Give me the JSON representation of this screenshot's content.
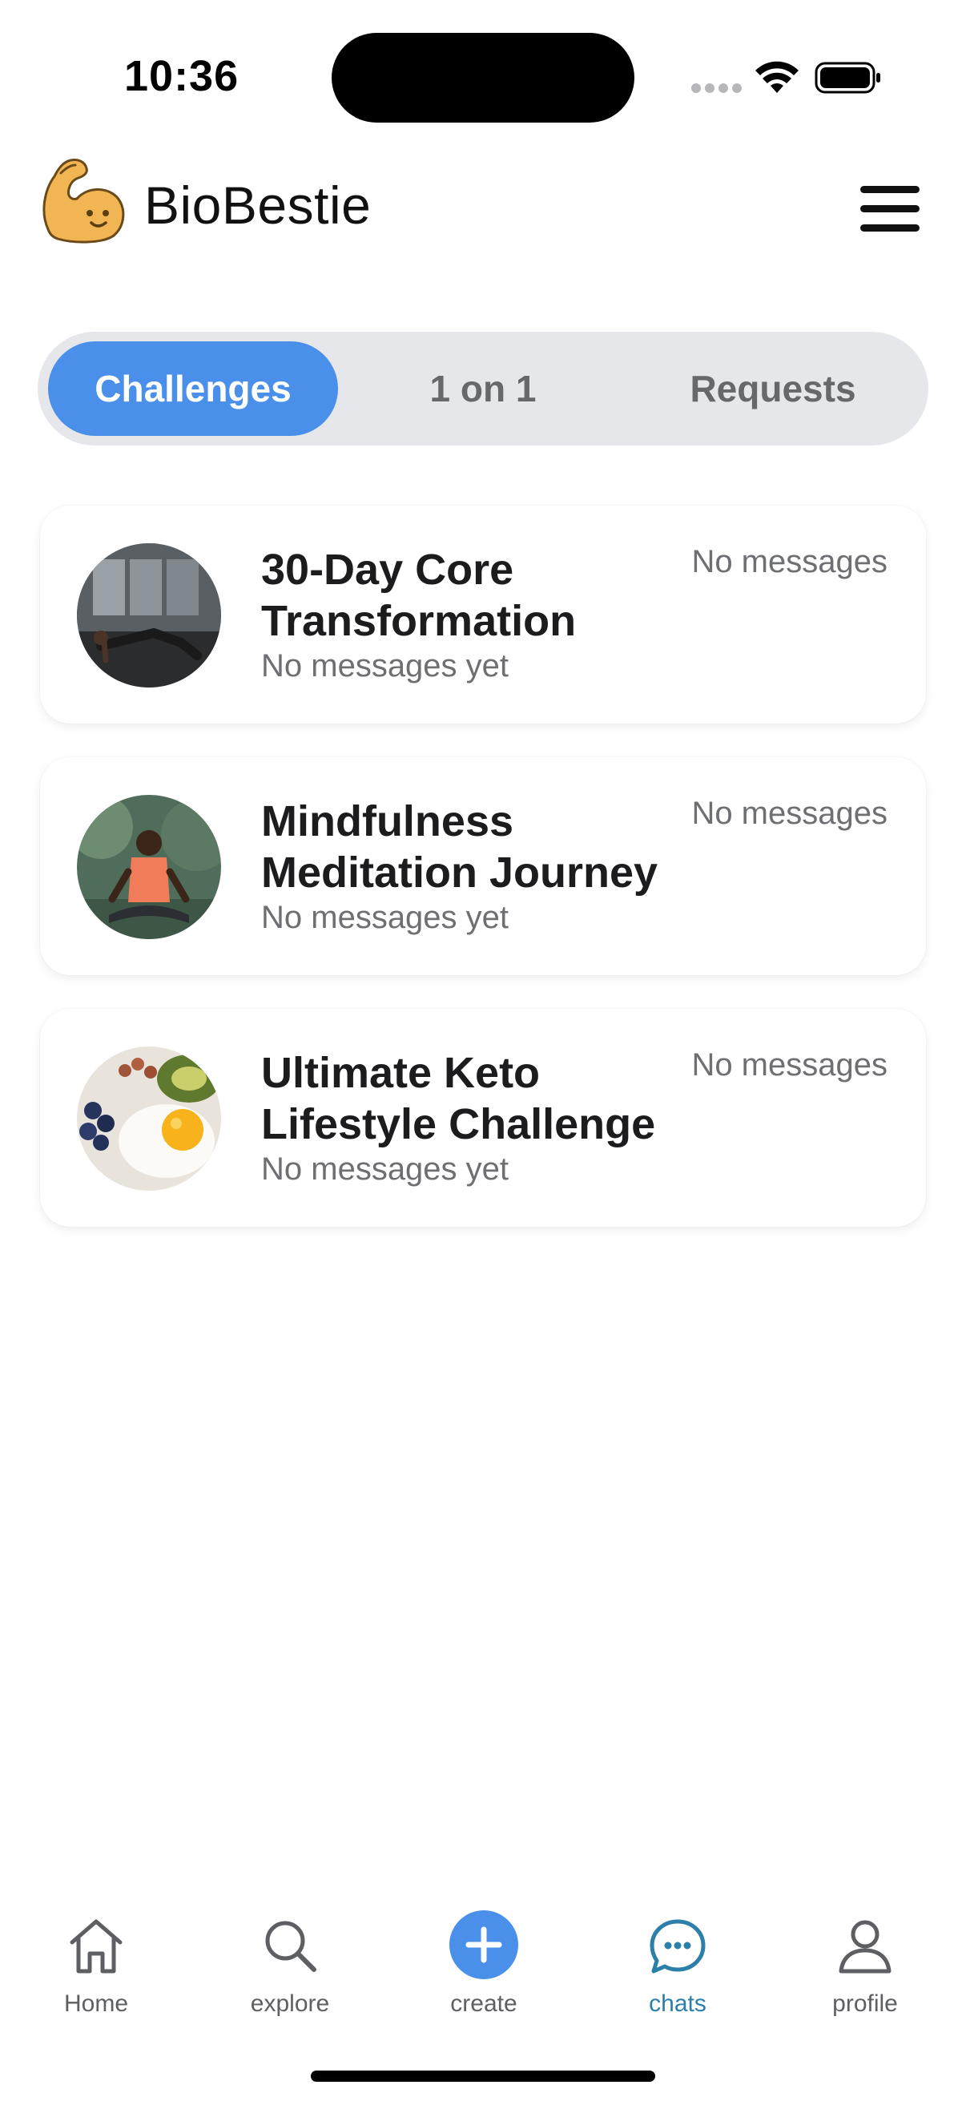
{
  "status_bar": {
    "time": "10:36"
  },
  "header": {
    "app_name": "BioBestie",
    "logo_icon": "flexed-biceps-icon",
    "menu_icon": "hamburger-menu-icon"
  },
  "tabs": [
    {
      "label": "Challenges",
      "active": true
    },
    {
      "label": "1 on 1",
      "active": false
    },
    {
      "label": "Requests",
      "active": false
    }
  ],
  "chats": [
    {
      "title": "30-Day Core Transformation",
      "preview": "No messages yet",
      "time": "No messages",
      "avatar_icon": "plank-workout-photo"
    },
    {
      "title": "Mindfulness Meditation Journey",
      "preview": "No messages yet",
      "time": "No messages",
      "avatar_icon": "meditation-photo"
    },
    {
      "title": "Ultimate Keto Lifestyle Challenge",
      "preview": "No messages yet",
      "time": "No messages",
      "avatar_icon": "keto-food-photo"
    }
  ],
  "bottom_nav": [
    {
      "label": "Home",
      "icon": "home-icon",
      "active": false
    },
    {
      "label": "explore",
      "icon": "search-icon",
      "active": false
    },
    {
      "label": "create",
      "icon": "plus-circle-icon",
      "active": false
    },
    {
      "label": "chats",
      "icon": "chat-bubble-icon",
      "active": true
    },
    {
      "label": "profile",
      "icon": "person-icon",
      "active": false
    }
  ],
  "colors": {
    "accent": "#4a8fe9",
    "active_nav": "#2c7fa8",
    "tab_track": "#e6e7ea",
    "muted_text": "#6e6f73"
  }
}
